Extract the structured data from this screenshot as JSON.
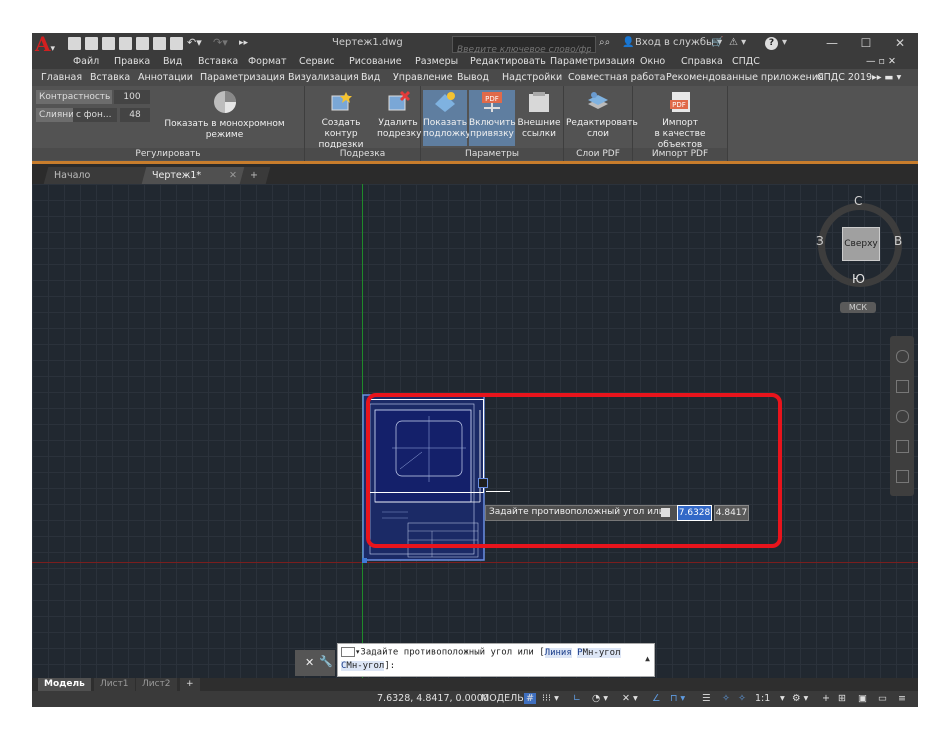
{
  "titlebar": {
    "doc_title": "Чертеж1.dwg",
    "search_placeholder": "Введите ключевое слово/фразу",
    "signin_label": "Вход в службы",
    "help_label": "?"
  },
  "menu": [
    "Файл",
    "Правка",
    "Вид",
    "Вставка",
    "Формат",
    "Сервис",
    "Рисование",
    "Размеры",
    "Редактировать",
    "Параметризация",
    "Окно",
    "Справка",
    "СПДС"
  ],
  "ribbon_tabs": [
    "Главная",
    "Вставка",
    "Аннотации",
    "Параметризация",
    "Визуализация",
    "Вид",
    "Управление",
    "Вывод",
    "Надстройки",
    "Совместная работа",
    "Рекомендованные приложения",
    "СПДС 2019"
  ],
  "ribbon": {
    "adjust": {
      "contrast_label": "Контрастность",
      "contrast_value": "100",
      "fade_label": "Слияни",
      "fade_mode": "с фон...",
      "fade_value": "48",
      "mono_label": "Показать в монохромном режиме",
      "title": "Регулировать"
    },
    "clip": {
      "create_label1": "Создать контур",
      "create_label2": "подрезки",
      "delete_label1": "Удалить",
      "delete_label2": "подрезку",
      "title": "Подрезка"
    },
    "options": {
      "show_label1": "Показать",
      "show_label2": "подложку",
      "snap_label1": "Включить",
      "snap_label2": "привязку",
      "ext_label1": "Внешние",
      "ext_label2": "ссылки",
      "title": "Параметры"
    },
    "pdf_layers": {
      "label1": "Редактировать",
      "label2": "слои",
      "title": "Слои PDF"
    },
    "pdf_import": {
      "label1": "Импорт",
      "label2": "в качестве объектов",
      "title": "Импорт PDF"
    }
  },
  "doc_tabs": {
    "start": "Начало",
    "current": "Чертеж1*",
    "new": "+"
  },
  "viewcube": {
    "north": "С",
    "south": "Ю",
    "west": "З",
    "east": "В",
    "face": "Сверху",
    "ucs": "МСК"
  },
  "prompt_tooltip": {
    "text": "Задайте противоположный угол или",
    "x_value": "7.6328",
    "y_value": "4.8417"
  },
  "command_line": {
    "history_prefix": "Задайте противоположный угол или [",
    "opt1": "Линия",
    "opt2_key": "Р",
    "opt2_rest": "Мн-угол",
    "opt3_key": "С",
    "opt3_rest": "Мн-угол",
    "suffix": "]:"
  },
  "layout_tabs": [
    "Модель",
    "Лист1",
    "Лист2"
  ],
  "status": {
    "coords": "7.6328, 4.8417, 0.0000",
    "space": "МОДЕЛЬ",
    "scale": "1:1"
  },
  "colors": {
    "highlight_box": "#e8141c",
    "ribbon_accent": "#c87d2c",
    "crosshair_green": "#1f8a2a",
    "crosshair_red": "#7a1e1e"
  }
}
